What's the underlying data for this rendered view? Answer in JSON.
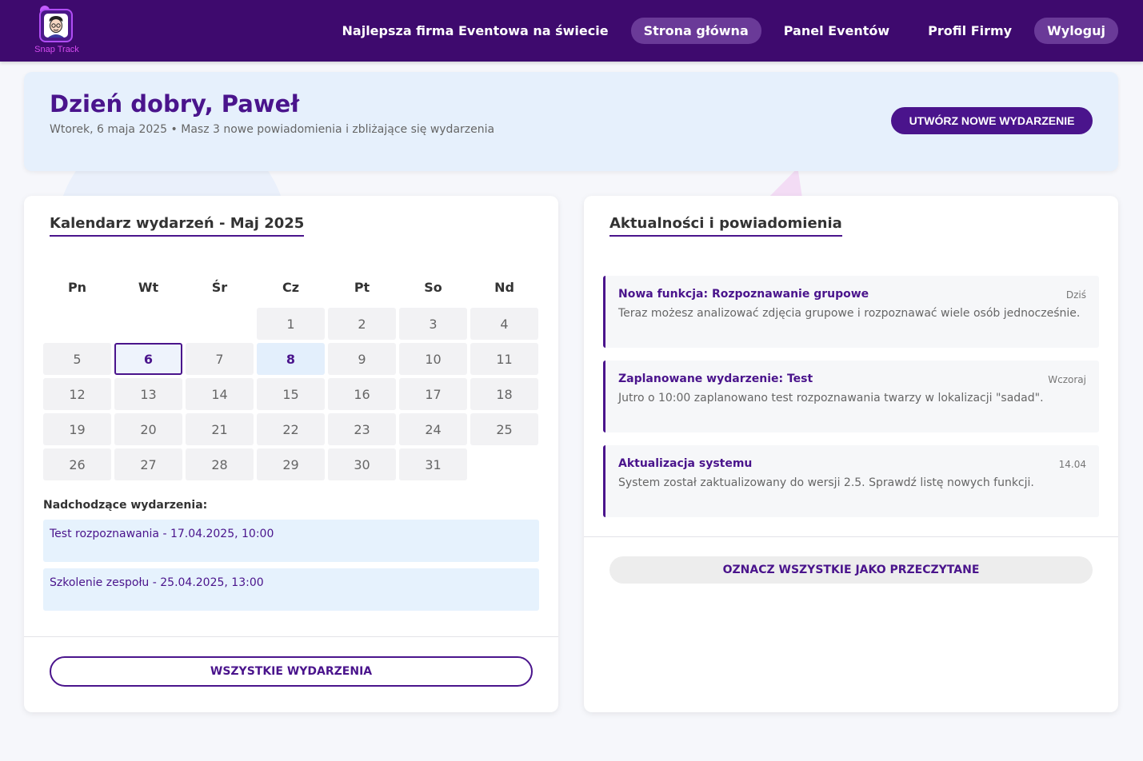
{
  "brand": {
    "name": "Snap Track",
    "accent": "#4a148c",
    "nav_bg": "#3e0a6e"
  },
  "nav": {
    "items": [
      {
        "label": "Najlepsza firma Eventowa na świecie",
        "style": "plain"
      },
      {
        "label": "Strona główna",
        "style": "pill"
      },
      {
        "label": "Panel Eventów",
        "style": "plain"
      },
      {
        "label": "Profil Firmy",
        "style": "plain"
      },
      {
        "label": "Wyloguj",
        "style": "pill"
      }
    ]
  },
  "welcome": {
    "title": "Dzień dobry, Paweł",
    "subtitle": "Wtorek, 6 maja 2025 • Masz 3 nowe powiadomienia i zbliżające się wydarzenia",
    "create_button": "UTWÓRZ NOWE WYDARZENIE"
  },
  "calendar": {
    "title": "Kalendarz wydarzeń - Maj 2025",
    "weekdays": [
      "Pn",
      "Wt",
      "Śr",
      "Cz",
      "Pt",
      "So",
      "Nd"
    ],
    "leading_blanks": 3,
    "days_in_month": 31,
    "today": 6,
    "event_days": [
      8
    ],
    "upcoming_title": "Nadchodzące wydarzenia:",
    "upcoming": [
      "Test rozpoznawania - 17.04.2025, 10:00",
      "Szkolenie zespołu - 25.04.2025, 13:00"
    ],
    "all_events_button": "WSZYSTKIE WYDARZENIA"
  },
  "news": {
    "title": "Aktualności i powiadomienia",
    "items": [
      {
        "title": "Nowa funkcja: Rozpoznawanie grupowe",
        "date": "Dziś",
        "text": "Teraz możesz analizować zdjęcia grupowe i rozpoznawać wiele osób jednocześnie."
      },
      {
        "title": "Zaplanowane wydarzenie: Test",
        "date": "Wczoraj",
        "text": "Jutro o 10:00 zaplanowano test rozpoznawania twarzy w lokalizacji \"sadad\"."
      },
      {
        "title": "Aktualizacja systemu",
        "date": "14.04",
        "text": "System został zaktualizowany do wersji 2.5. Sprawdź listę nowych funkcji."
      }
    ],
    "mark_read_button": "OZNACZ WSZYSTKIE JAKO PRZECZYTANE"
  }
}
